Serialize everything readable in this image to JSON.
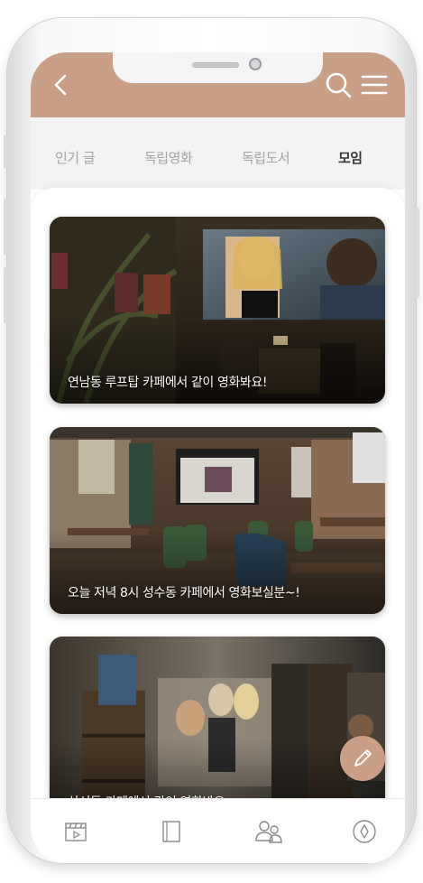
{
  "tabs": [
    {
      "label": "인기 글"
    },
    {
      "label": "독립영화"
    },
    {
      "label": "독립도서"
    },
    {
      "label": "모임"
    }
  ],
  "active_tab": "모임",
  "posts": [
    {
      "caption": "연남동 루프탑 카페에서 같이 영화봐요!"
    },
    {
      "caption": "오늘 저녁 8시 성수동 카페에서 영화보실분~!"
    },
    {
      "caption": "삼성동 카페에서 같이 영화봐요~"
    }
  ],
  "colors": {
    "accent": "#c99f85",
    "tab_inactive": "#a3a3a6",
    "tab_active": "#333333"
  },
  "icons": {
    "header": [
      "back-arrow-icon",
      "search-icon",
      "hamburger-menu-icon"
    ],
    "fab": "pencil-icon",
    "bottom_nav": [
      "clapperboard-icon",
      "book-icon",
      "people-icon",
      "compass-icon"
    ]
  }
}
